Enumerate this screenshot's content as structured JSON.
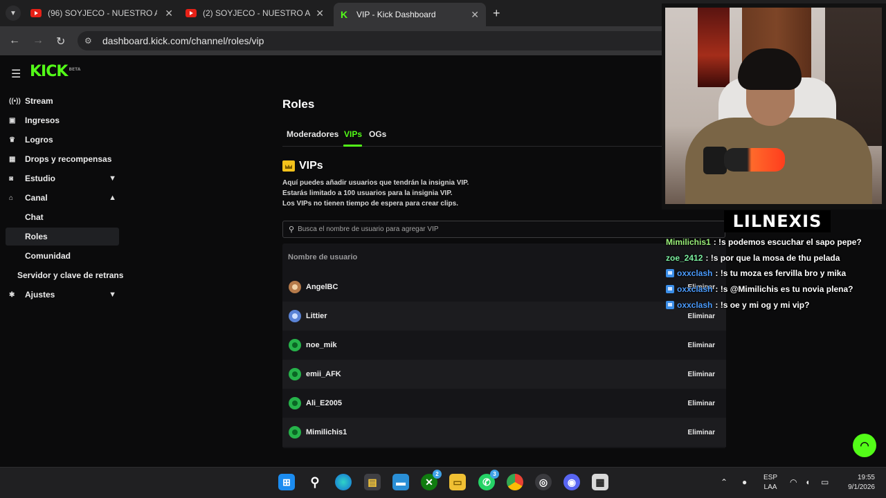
{
  "browser": {
    "tabs": [
      {
        "title": "(96) SOYJECO - NUESTRO AMOR",
        "favicon": "youtube-icon"
      },
      {
        "title": "(2) SOYJECO - NUESTRO AMOR",
        "favicon": "youtube-icon"
      },
      {
        "title": "VIP - Kick Dashboard",
        "favicon": "kick-icon",
        "active": true
      }
    ],
    "url": "dashboard.kick.com/channel/roles/vip"
  },
  "sidebar": {
    "logo": "KICK",
    "logo_tag": "BETA",
    "items": [
      {
        "label": "Stream",
        "icon": "broadcast-icon"
      },
      {
        "label": "Ingresos",
        "icon": "wallet-icon"
      },
      {
        "label": "Logros",
        "icon": "trophy-icon"
      },
      {
        "label": "Drops y recompensas",
        "icon": "gift-icon"
      },
      {
        "label": "Estudio",
        "icon": "studio-icon"
      },
      {
        "label": "Canal",
        "icon": "channel-icon"
      },
      {
        "label": "Chat"
      },
      {
        "label": "Roles"
      },
      {
        "label": "Comunidad"
      },
      {
        "label": "Servidor y clave de retrans"
      },
      {
        "label": "Ajustes",
        "icon": "settings-icon"
      }
    ]
  },
  "main": {
    "title": "Roles",
    "tabs": [
      "Moderadores",
      "VIPs",
      "OGs"
    ],
    "active_tab": "VIPs",
    "section_title": "VIPs",
    "description": [
      "Aquí puedes añadir usuarios que tendrán la insignia VIP.",
      "Estarás limitado a 100 usuarios para la insignia VIP.",
      "Los VIPs no tienen tiempo de espera para crear clips."
    ],
    "search_placeholder": "Busca el nombre de usuario para agregar VIP",
    "column_header": "Nombre de usuario",
    "remove_label": "Eliminar",
    "users": [
      "AngelBC",
      "Littier",
      "noe_mik",
      "emii_AFK",
      "Ali_E2005",
      "Mimilichis1"
    ]
  },
  "overlay": {
    "streamer_name": "LILNEXIS",
    "chat": [
      {
        "user": "Mimilichis1",
        "message": "!s podemos escuchar el sapo pepe?",
        "color": "#9bf07a",
        "badge": false
      },
      {
        "user": "zoe_2412",
        "message": "!s por que la mosa de thu pelada",
        "color": "#7cf0a0",
        "badge": false
      },
      {
        "user": "oxxclash",
        "message": "!s tu moza es fervilla bro y mika",
        "color": "#4b9cff",
        "badge": true
      },
      {
        "user": "oxxclash",
        "message": "!s @Mimilichis es tu novia plena?",
        "color": "#4b9cff",
        "badge": true
      },
      {
        "user": "oxxclash",
        "message": "!s oe y mi og y mi vip?",
        "color": "#4b9cff",
        "badge": true
      }
    ]
  },
  "taskbar": {
    "language": [
      "ESP",
      "LAA"
    ],
    "time": "19:55",
    "date": "9/1/2026",
    "badges": {
      "xbox": "2",
      "whatsapp": "3"
    }
  },
  "colors": {
    "accent": "#53fc18",
    "background": "#0b0b0c"
  }
}
